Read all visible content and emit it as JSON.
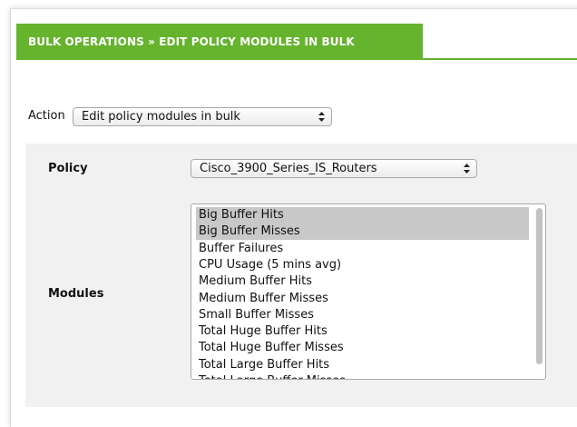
{
  "header": {
    "title": "BULK OPERATIONS » EDIT POLICY MODULES IN BULK",
    "accent_color": "#66b32e"
  },
  "action": {
    "label": "Action",
    "selected": "Edit policy modules in bulk",
    "arrow_icon": "updown-arrows-icon"
  },
  "form": {
    "policy_label": "Policy",
    "policy_selected": "Cisco_3900_Series_IS_Routers",
    "modules_label": "Modules",
    "modules": [
      {
        "label": "Big Buffer Hits",
        "selected": true
      },
      {
        "label": "Big Buffer Misses",
        "selected": true
      },
      {
        "label": "Buffer Failures",
        "selected": false
      },
      {
        "label": "CPU Usage (5 mins avg)",
        "selected": false
      },
      {
        "label": "Medium Buffer Hits",
        "selected": false
      },
      {
        "label": "Medium Buffer Misses",
        "selected": false
      },
      {
        "label": "Small Buffer Misses",
        "selected": false
      },
      {
        "label": "Total Huge Buffer Hits",
        "selected": false
      },
      {
        "label": "Total Huge Buffer Misses",
        "selected": false
      },
      {
        "label": "Total Large Buffer Hits",
        "selected": false
      },
      {
        "label": "Total Large Buffer Misses",
        "selected": false
      }
    ]
  }
}
